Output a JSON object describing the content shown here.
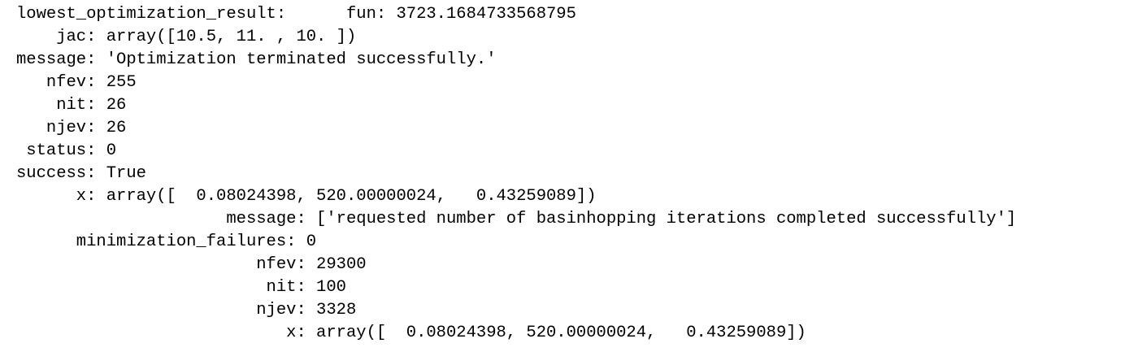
{
  "output": {
    "lines": [
      "lowest_optimization_result:      fun: 3723.1684733568795",
      "    jac: array([10.5, 11. , 10. ])",
      "message: 'Optimization terminated successfully.'",
      "   nfev: 255",
      "    nit: 26",
      "   njev: 26",
      " status: 0",
      "success: True",
      "      x: array([  0.08024398, 520.00000024,   0.43259089])",
      "                     message: ['requested number of basinhopping iterations completed successfully']",
      "      minimization_failures: 0",
      "                        nfev: 29300",
      "                         nit: 100",
      "                        njev: 3328",
      "                           x: array([  0.08024398, 520.00000024,   0.43259089])"
    ]
  }
}
